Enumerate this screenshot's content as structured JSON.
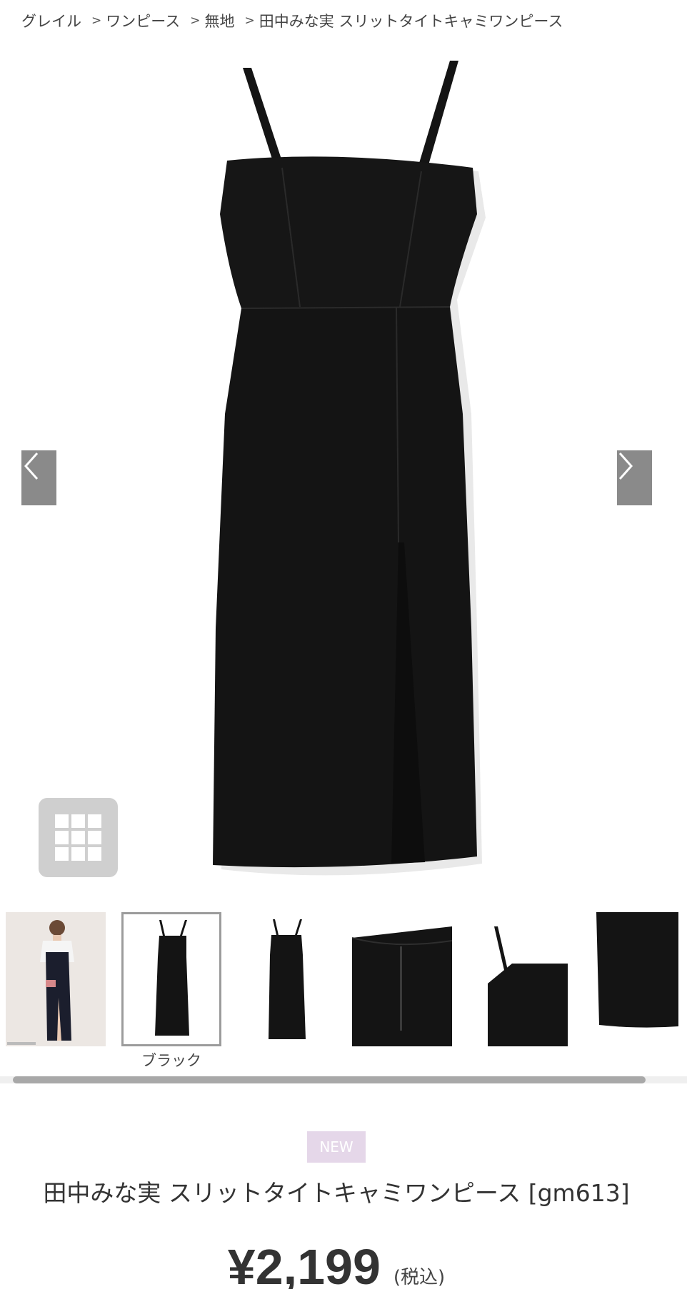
{
  "breadcrumb": {
    "items": [
      {
        "label": "グレイル"
      },
      {
        "label": "ワンピース"
      },
      {
        "label": "無地"
      },
      {
        "label": "田中みな実 スリットタイトキャミワンピース"
      }
    ],
    "separator": ">"
  },
  "gallery": {
    "prev_icon": "chevron-left-icon",
    "next_icon": "chevron-right-icon",
    "grid_icon": "grid-icon",
    "thumbnails": [
      {
        "alt": "model-wearing-dress"
      },
      {
        "alt": "dress-front-black",
        "caption": "ブラック",
        "selected": true
      },
      {
        "alt": "dress-back"
      },
      {
        "alt": "dress-back-zipper-detail"
      },
      {
        "alt": "dress-strap-detail"
      },
      {
        "alt": "dress-fabric-detail"
      }
    ]
  },
  "product": {
    "badge": "NEW",
    "name": "田中みな実 スリットタイトキャミワンピース [gm613]",
    "price": "¥2,199",
    "tax_note": "(税込)"
  },
  "colors": {
    "badge_bg": "#e5d7e9",
    "arrow_bg": "#8a8a8a",
    "dress": "#141414"
  }
}
